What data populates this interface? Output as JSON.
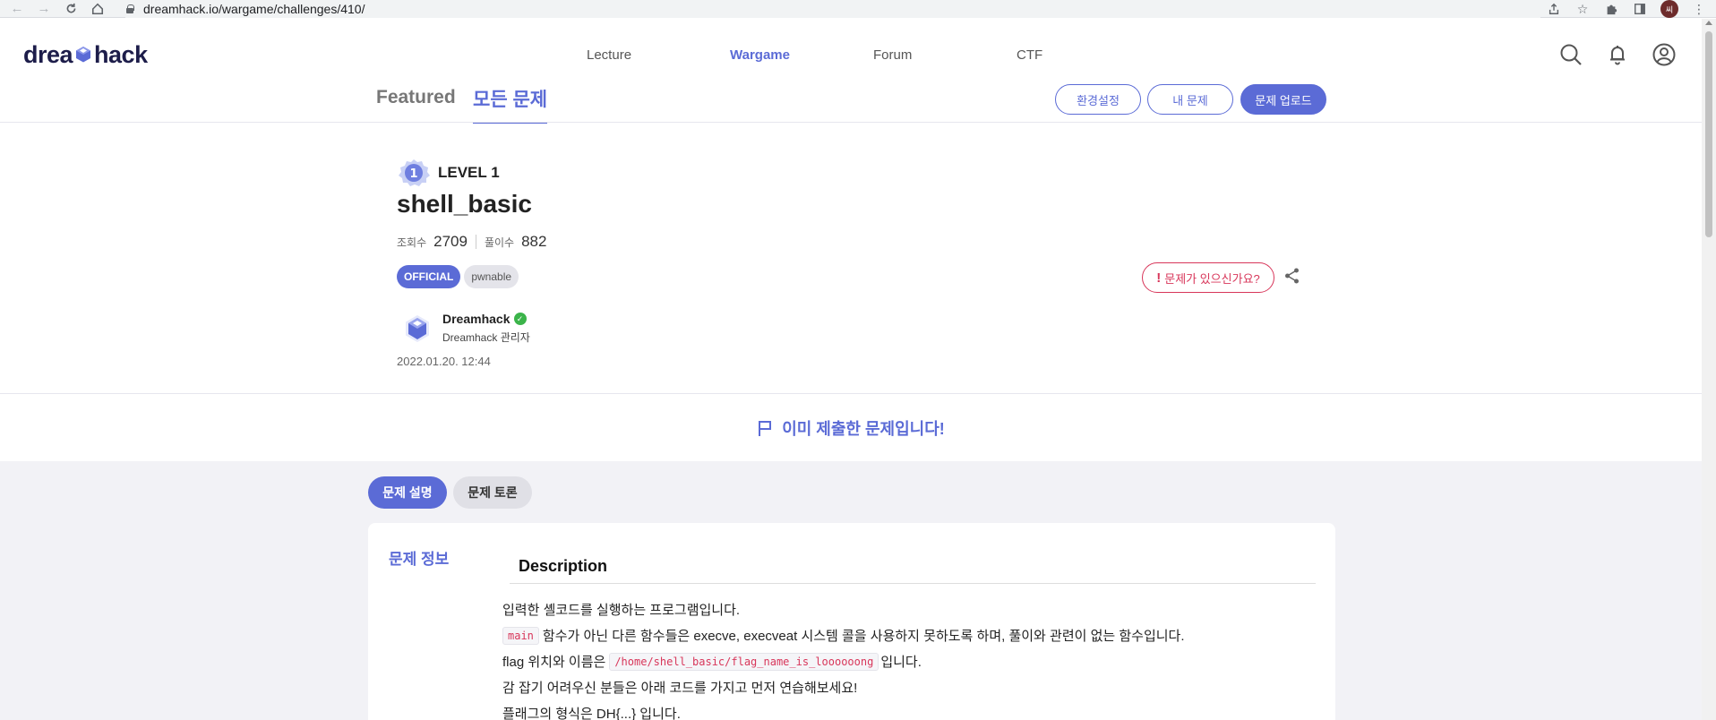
{
  "browser": {
    "url": "dreamhack.io/wargame/challenges/410/",
    "profile_initial": "씨"
  },
  "header": {
    "logo": {
      "left": "drea",
      "right": "hack"
    },
    "nav": [
      {
        "label": "Lecture",
        "active": false
      },
      {
        "label": "Wargame",
        "active": true
      },
      {
        "label": "Forum",
        "active": false
      },
      {
        "label": "CTF",
        "active": false
      }
    ]
  },
  "subheader": {
    "tab_featured": "Featured",
    "tab_all": "모든 문제",
    "buttons": {
      "settings": "환경설정",
      "my_problems": "내 문제",
      "upload": "문제 업로드"
    }
  },
  "challenge": {
    "level_num": "1",
    "level_label": "LEVEL 1",
    "title": "shell_basic",
    "views_label": "조회수",
    "views": "2709",
    "solves_label": "풀이수",
    "solves": "882",
    "tags": [
      "OFFICIAL",
      "pwnable"
    ],
    "report_label": "문제가 있으신가요?",
    "author_name": "Dreamhack",
    "author_role": "Dreamhack 관리자",
    "date": "2022.01.20. 12:44"
  },
  "solved_banner": "이미 제출한 문제입니다!",
  "content_tabs": {
    "description": "문제 설명",
    "discussion": "문제 토론"
  },
  "card": {
    "side_label": "문제 정보",
    "heading": "Description",
    "lines": {
      "l1": "입력한 셸코드를 실행하는 프로그램입니다.",
      "l2_code": "main",
      "l2_text": "함수가 아닌 다른 함수들은 execve, execveat 시스템 콜을 사용하지 못하도록 하며, 풀이와 관련이 없는 함수입니다.",
      "l3_pre": "flag 위치와 이름은",
      "l3_code": "/home/shell_basic/flag_name_is_loooooong",
      "l3_post": "입니다.",
      "l4": "감 잡기 어려우신 분들은 아래 코드를 가지고 먼저 연습해보세요!",
      "l5": "플래그의 형식은 DH{...} 입니다."
    }
  },
  "colors": {
    "accent": "#5b6bd6",
    "danger": "#d8365a",
    "verified": "#3bb44a"
  }
}
